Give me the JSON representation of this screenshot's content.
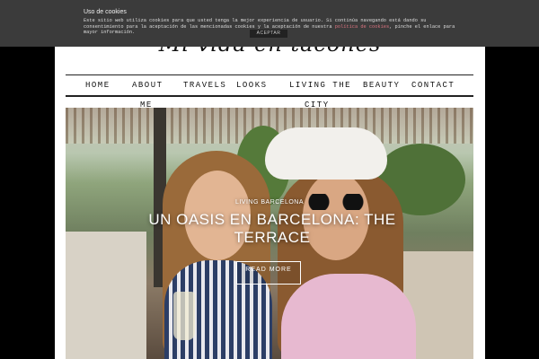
{
  "site": {
    "logo_text": "Mi vida en tacones"
  },
  "nav": {
    "items": [
      {
        "label": "HOME"
      },
      {
        "label": "ABOUT",
        "sub": "ME"
      },
      {
        "label": "TRAVELS"
      },
      {
        "label": "LOOKS"
      },
      {
        "label": "LIVING THE",
        "sub": "CITY"
      },
      {
        "label": "BEAUTY"
      },
      {
        "label": "CONTACT"
      }
    ]
  },
  "hero": {
    "category": "LIVING BARCELONA",
    "title": "UN OASIS EN BARCELONA: THE TERRACE",
    "read_more": "READ MORE"
  },
  "cookie_bar": {
    "title": "Uso de cookies",
    "text_before_link1": "Este sitio web utiliza cookies para que usted tenga la mejor experiencia de usuario. Si continúa navegando está dando su consentimiento para la aceptación de las mencionadas cookies y la aceptación de nuestra ",
    "link1": "política de cookies",
    "text_after_link1": ", pinche el enlace para mayor información.",
    "accept_label": "ACEPTAR",
    "link_color": "#d9737f",
    "background_color": "#3b3b3b"
  }
}
